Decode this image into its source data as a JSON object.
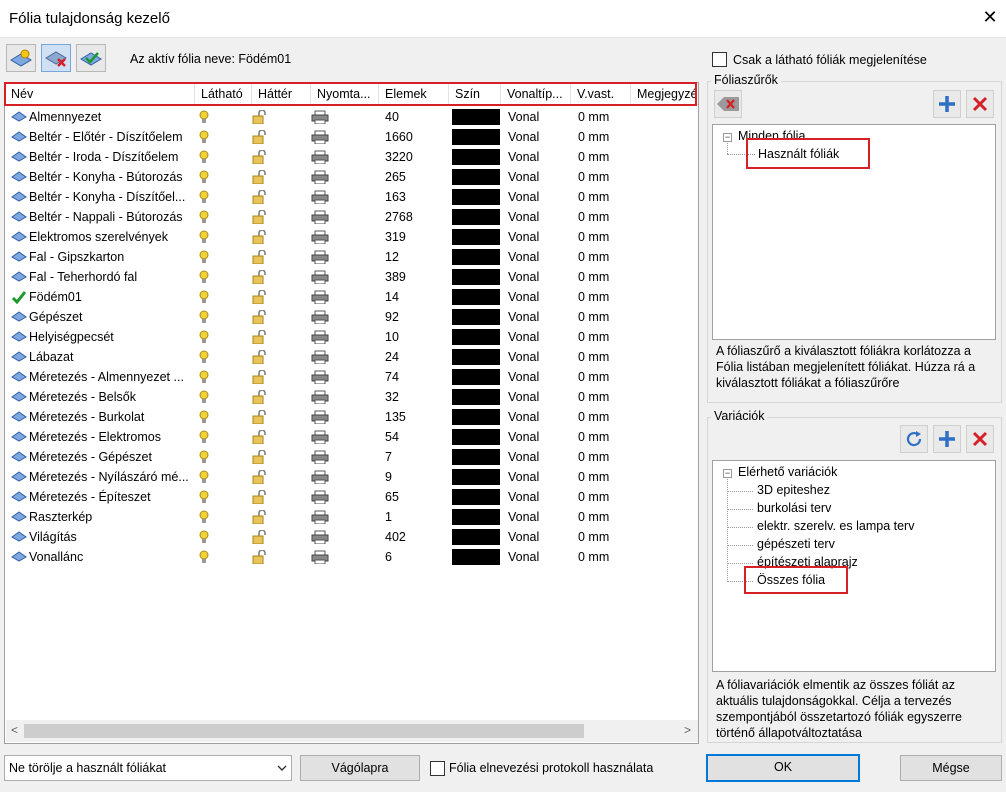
{
  "window": {
    "title": "Fólia tulajdonság kezelő",
    "close_glyph": "✕"
  },
  "toolbar": {
    "buttons": [
      "new-layer-icon",
      "delete-layer-icon",
      "set-active-layer-icon"
    ],
    "active_layer_text": "Az aktív fólia neve: Födém01"
  },
  "grid": {
    "columns": [
      "Név",
      "Látható",
      "Háttér",
      "Nyomta...",
      "Elemek",
      "Szín",
      "Vonaltíp...",
      "V.vast.",
      "Megjegyzé"
    ],
    "rows": [
      {
        "name": "Almennyezet",
        "count": "40",
        "line": "Vonal",
        "width": "0 mm",
        "icon": "layer-icon"
      },
      {
        "name": "Beltér - Előtér - Díszítőelem",
        "count": "1660",
        "line": "Vonal",
        "width": "0 mm",
        "icon": "layer-icon"
      },
      {
        "name": "Beltér - Iroda - Díszítőelem",
        "count": "3220",
        "line": "Vonal",
        "width": "0 mm",
        "icon": "layer-icon"
      },
      {
        "name": "Beltér - Konyha - Bútorozás",
        "count": "265",
        "line": "Vonal",
        "width": "0 mm",
        "icon": "layer-icon"
      },
      {
        "name": "Beltér - Konyha - Díszítőel...",
        "count": "163",
        "line": "Vonal",
        "width": "0 mm",
        "icon": "layer-icon"
      },
      {
        "name": "Beltér - Nappali - Bútorozás",
        "count": "2768",
        "line": "Vonal",
        "width": "0 mm",
        "icon": "layer-icon"
      },
      {
        "name": "Elektromos szerelvények",
        "count": "319",
        "line": "Vonal",
        "width": "0 mm",
        "icon": "layer-icon"
      },
      {
        "name": "Fal - Gipszkarton",
        "count": "12",
        "line": "Vonal",
        "width": "0 mm",
        "icon": "layer-icon"
      },
      {
        "name": "Fal - Teherhordó fal",
        "count": "389",
        "line": "Vonal",
        "width": "0 mm",
        "icon": "layer-icon"
      },
      {
        "name": "Födém01",
        "count": "14",
        "line": "Vonal",
        "width": "0 mm",
        "icon": "active-check-icon"
      },
      {
        "name": "Gépészet",
        "count": "92",
        "line": "Vonal",
        "width": "0 mm",
        "icon": "layer-icon"
      },
      {
        "name": "Helyiségpecsét",
        "count": "10",
        "line": "Vonal",
        "width": "0 mm",
        "icon": "layer-icon"
      },
      {
        "name": "Lábazat",
        "count": "24",
        "line": "Vonal",
        "width": "0 mm",
        "icon": "layer-icon"
      },
      {
        "name": "Méretezés - Almennyezet ...",
        "count": "74",
        "line": "Vonal",
        "width": "0 mm",
        "icon": "layer-icon"
      },
      {
        "name": "Méretezés - Belsők",
        "count": "32",
        "line": "Vonal",
        "width": "0 mm",
        "icon": "layer-icon"
      },
      {
        "name": "Méretezés - Burkolat",
        "count": "135",
        "line": "Vonal",
        "width": "0 mm",
        "icon": "layer-icon"
      },
      {
        "name": "Méretezés - Elektromos",
        "count": "54",
        "line": "Vonal",
        "width": "0 mm",
        "icon": "layer-icon"
      },
      {
        "name": "Méretezés - Gépészet",
        "count": "7",
        "line": "Vonal",
        "width": "0 mm",
        "icon": "layer-icon"
      },
      {
        "name": "Méretezés - Nyílászáró mé...",
        "count": "9",
        "line": "Vonal",
        "width": "0 mm",
        "icon": "layer-icon"
      },
      {
        "name": "Méretezés - Építeszet",
        "count": "65",
        "line": "Vonal",
        "width": "0 mm",
        "icon": "layer-icon"
      },
      {
        "name": "Raszterkép",
        "count": "1",
        "line": "Vonal",
        "width": "0 mm",
        "icon": "layer-icon"
      },
      {
        "name": "Világítás",
        "count": "402",
        "line": "Vonal",
        "width": "0 mm",
        "icon": "layer-icon"
      },
      {
        "name": "Vonallánc",
        "count": "6",
        "line": "Vonal",
        "width": "0 mm",
        "icon": "layer-icon"
      }
    ],
    "scroll_left_glyph": "<",
    "scroll_right_glyph": ">"
  },
  "right": {
    "visible_only_label": "Csak a látható fóliák megjelenítése",
    "filters": {
      "title": "Fóliaszűrők",
      "root": "Minden fólia",
      "child": "Használt fóliák",
      "description": "A fóliaszűrő a kiválasztott fóliákra korlátozza a Fólia listában megjelenített fóliákat. Húzza rá a kiválasztott fóliákat a fóliaszűrőre"
    },
    "variations": {
      "title": "Variációk",
      "root": "Elérhető variációk",
      "items": [
        "3D epiteshez",
        "burkolási terv",
        "elektr. szerelv. es lampa terv",
        "gépészeti terv",
        "építészeti alaprajz",
        "Összes fólia"
      ],
      "description": "A fóliavariációk elmentik az összes fóliát az aktuális tulajdonságokkal. Célja a tervezés szempontjából összetartozó fóliák egyszerre történő állapotváltoztatása"
    }
  },
  "bottom": {
    "delete_option": "Ne törölje a használt fóliákat",
    "clipboard_button": "Vágólapra",
    "naming_protocol_label": "Fólia elnevezési protokoll használata",
    "ok_button": "OK",
    "cancel_button": "Mégse"
  },
  "colors": {
    "highlight": "#d71f26",
    "accent": "#0078d7",
    "layer_color": "#000000"
  }
}
